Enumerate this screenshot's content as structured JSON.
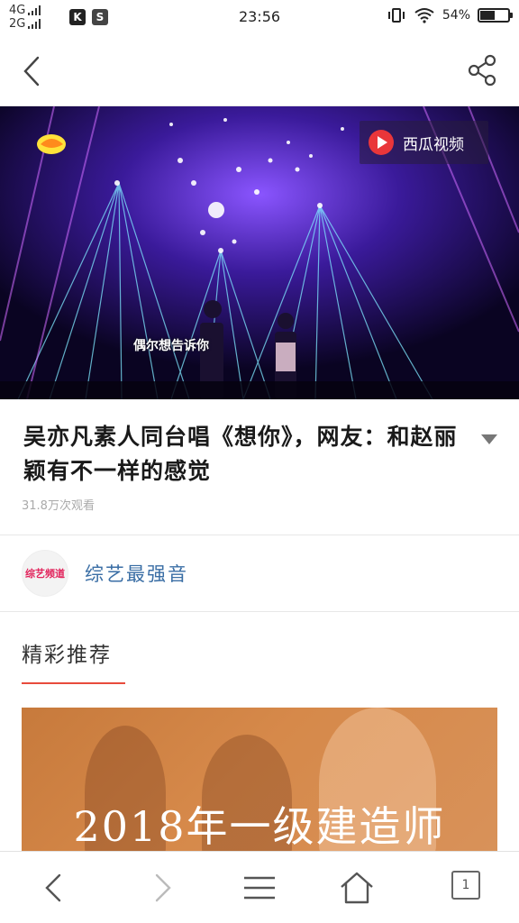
{
  "status_bar": {
    "network_1": "4G",
    "network_2": "2G",
    "app_icon_1": "K",
    "app_icon_2": "S",
    "time": "23:56",
    "battery_text": "54%",
    "battery_level": 0.54
  },
  "nav": {
    "back_icon": "chevron-left-icon",
    "share_icon": "share-icon"
  },
  "video": {
    "watermark": "西瓜视频",
    "caption": "偶尔想告诉你"
  },
  "article": {
    "title": "吴亦凡素人同台唱《想你》，网友：和赵丽颖有不一样的感觉",
    "views": "31.8万次观看"
  },
  "channel": {
    "avatar_text": "综艺频道",
    "name": "综艺最强音"
  },
  "recommend": {
    "heading": "精彩推荐",
    "card_text": "2018年一级建造师"
  },
  "bottom_bar": {
    "tab_count": "1"
  },
  "colors": {
    "accent": "#e84b3c",
    "channel_link": "#3a6ea5"
  }
}
